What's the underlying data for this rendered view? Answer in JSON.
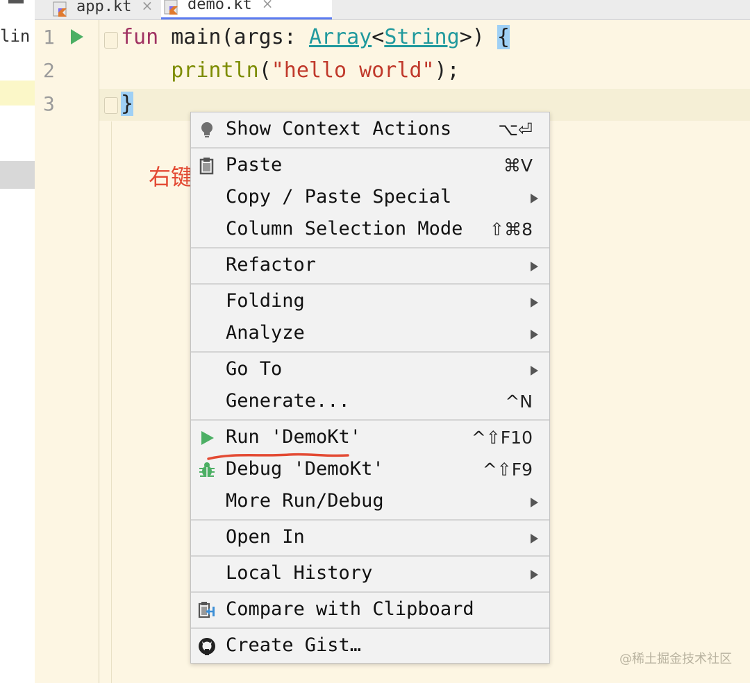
{
  "project_panel": {
    "visible_text": "lin"
  },
  "tabs": [
    {
      "label": "app.kt",
      "close": "×"
    },
    {
      "label": "demo.kt",
      "close": "×"
    }
  ],
  "editor": {
    "line_numbers": [
      "1",
      "2",
      "3"
    ],
    "line1": {
      "kw": "fun",
      "name": " main(args: ",
      "type1": "Array",
      "lt": "<",
      "type2": "String",
      "rest": ">) ",
      "brace": "{"
    },
    "line2": {
      "indent": "    ",
      "call": "println",
      "open": "(",
      "str": "\"hello world\"",
      "close": ");"
    },
    "line3": {
      "brace": "}"
    }
  },
  "annotation": "右键",
  "context_menu": {
    "items": [
      {
        "label": "Show Context Actions",
        "shortcut": "⌥⏎",
        "icon": "lightbulb-icon"
      },
      {
        "label": "Paste",
        "shortcut": "⌘V",
        "icon": "clipboard-icon"
      },
      {
        "label": "Copy / Paste Special",
        "submenu": true
      },
      {
        "label": "Column Selection Mode",
        "shortcut": "⇧⌘8"
      },
      {
        "label": "Refactor",
        "submenu": true
      },
      {
        "label": "Folding",
        "submenu": true
      },
      {
        "label": "Analyze",
        "submenu": true
      },
      {
        "label": "Go To",
        "submenu": true
      },
      {
        "label": "Generate...",
        "shortcut": "^N"
      },
      {
        "label": "Run 'DemoKt'",
        "shortcut": "^⇧F10",
        "icon": "run-icon"
      },
      {
        "label": "Debug 'DemoKt'",
        "shortcut": "^⇧F9",
        "icon": "debug-bug-icon"
      },
      {
        "label": "More Run/Debug",
        "submenu": true
      },
      {
        "label": "Open In",
        "submenu": true
      },
      {
        "label": "Local History",
        "submenu": true
      },
      {
        "label": "Compare with Clipboard",
        "icon": "compare-clipboard-icon"
      },
      {
        "label": "Create Gist…",
        "icon": "github-icon"
      }
    ]
  },
  "watermark": "@稀土掘金技术社区",
  "colors": {
    "editor_bg": "#fdf6e3",
    "keyword": "#a03262",
    "type": "#20999d",
    "string": "#c0392b",
    "run_green": "#4caf64",
    "annotation_red": "#e34a33"
  }
}
